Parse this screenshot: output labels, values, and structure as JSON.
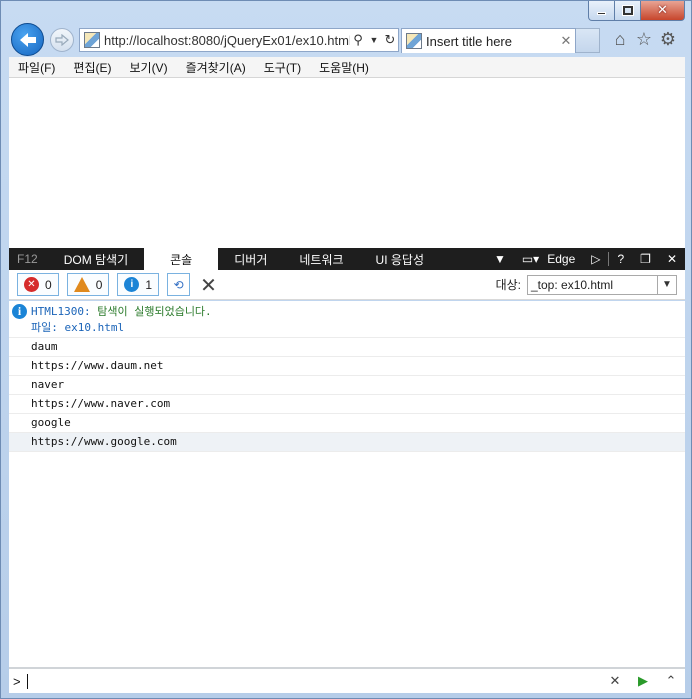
{
  "window": {
    "address": "http://localhost:8080/jQueryEx01/ex10.html",
    "tab_title": "Insert title here"
  },
  "menubar": {
    "items": [
      "파일(F)",
      "편집(E)",
      "보기(V)",
      "즐겨찾기(A)",
      "도구(T)",
      "도움말(H)"
    ]
  },
  "devtools": {
    "f12_label": "F12",
    "tabs": [
      {
        "label": "DOM 탐색기",
        "active": false
      },
      {
        "label": "콘솔",
        "active": true
      },
      {
        "label": "디버거",
        "active": false
      },
      {
        "label": "네트워크",
        "active": false
      },
      {
        "label": "UI 응답성",
        "active": false
      }
    ],
    "mode_label": "Edge",
    "help_label": "?"
  },
  "console": {
    "filters": {
      "errors": "0",
      "warnings": "0",
      "info": "1"
    },
    "target_label": "대상:",
    "target_value": "_top: ex10.html",
    "message": {
      "code": "HTML1300:",
      "text": "탐색이 실행되었습니다.",
      "source_label": "파일:",
      "source_file": "ex10.html"
    },
    "lines": [
      "daum",
      "https://www.daum.net",
      "naver",
      "https://www.naver.com",
      "google",
      "https://www.google.com"
    ],
    "prompt": ">"
  },
  "colors": {
    "devtools_bar": "#1e1e1e",
    "info_blue": "#1b84d6",
    "message_green": "#2a7a2a",
    "link_blue": "#1b64b8",
    "ie_back_blue": "#1565c0"
  }
}
